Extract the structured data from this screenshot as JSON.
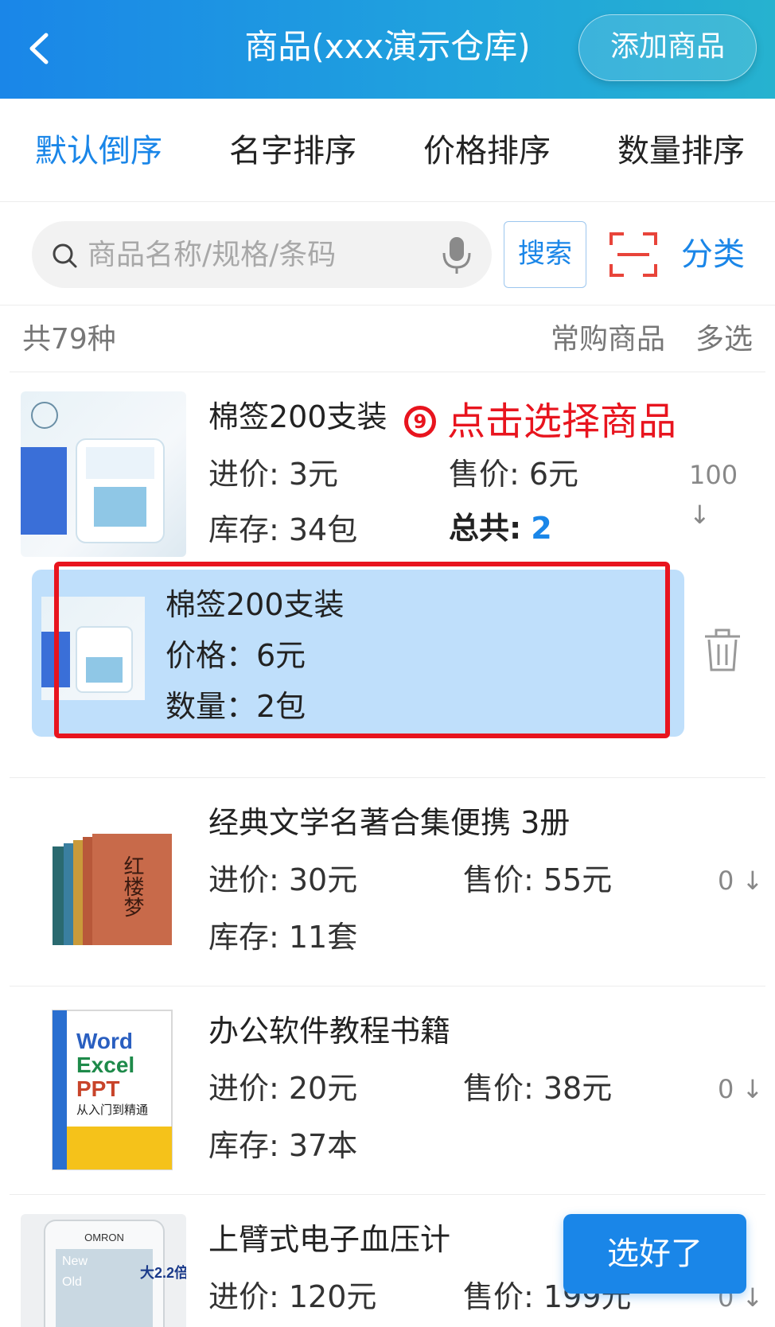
{
  "header": {
    "title": "商品(xxx演示仓库)",
    "add_button": "添加商品"
  },
  "sort_tabs": [
    {
      "label": "默认倒序",
      "active": true
    },
    {
      "label": "名字排序",
      "active": false
    },
    {
      "label": "价格排序",
      "active": false
    },
    {
      "label": "数量排序",
      "active": false
    }
  ],
  "search": {
    "placeholder": "商品名称/规格/条码",
    "button": "搜索",
    "category": "分类"
  },
  "summary": {
    "count": "共79种",
    "frequent": "常购商品",
    "multi_select": "多选"
  },
  "annotation": {
    "step": "9",
    "text": "点击选择商品"
  },
  "products": [
    {
      "name": "棉签200支装",
      "purchase_price": "进价: 3元",
      "sale_price": "售价: 6元",
      "stock": "库存: 34包",
      "total_label": "总共:",
      "total_value": "2",
      "qty_control": "100 ↓"
    },
    {
      "name": "经典文学名著合集便携 3册",
      "purchase_price": "进价: 30元",
      "sale_price": "售价: 55元",
      "stock": "库存: 11套",
      "qty_control": "0 ↓"
    },
    {
      "name": "办公软件教程书籍",
      "purchase_price": "进价: 20元",
      "sale_price": "售价: 38元",
      "stock": "库存: 37本",
      "qty_control": "0 ↓"
    },
    {
      "name": "上臂式电子血压计",
      "purchase_price": "进价: 120元",
      "sale_price": "售价: 199元",
      "qty_control": "0 ↓"
    }
  ],
  "selected_item": {
    "name": "棉签200支装",
    "price": "价格：6元",
    "quantity": "数量：2包"
  },
  "done_button": "选好了",
  "thumbnail_text": {
    "office_word": "Word",
    "office_excel": "Excel",
    "office_ppt": "PPT",
    "office_subtitle": "从入门到精通",
    "bp_brand": "OMRON",
    "bp_new": "New",
    "bp_old": "Old",
    "bp_badge": "大2.2倍",
    "book_title": "红楼梦"
  }
}
